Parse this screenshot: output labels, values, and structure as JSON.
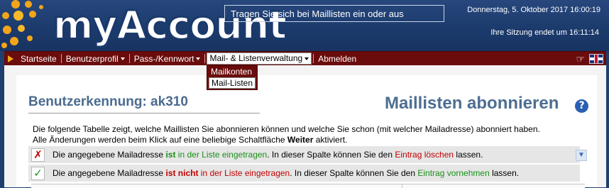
{
  "header": {
    "logo_text": "myAccount",
    "topic": "Tragen Sie sich bei Maillisten ein oder aus",
    "date": "Donnerstag, 5. Oktober 2017 16:00:19",
    "session": "Ihre Sitzung endet um 16:11:14"
  },
  "nav": {
    "items": [
      {
        "label": "Startseite"
      },
      {
        "label": "Benutzerprofil"
      },
      {
        "label": "Pass-/Kennwort"
      },
      {
        "label": "Mail- & Listenverwaltung"
      },
      {
        "label": "Abmelden"
      }
    ],
    "dropdown": [
      {
        "label": "Mailkonten"
      },
      {
        "label": "Mail-Listen"
      }
    ]
  },
  "main": {
    "user_id": "Benutzerkennung: ak310",
    "page_title": "Maillisten abonnieren",
    "intro_line1": "Die folgende Tabelle zeigt, welche Maillisten Sie abonnieren können und welche Sie schon (mit welcher Mailadresse) abonniert haben.",
    "intro_line2_pre": "Alle Änderungen werden beim Klick auf eine beliebige Schaltfläche ",
    "intro_line2_bold": "Weiter",
    "intro_line2_post": " aktiviert.",
    "legend": [
      {
        "icon": "cross-icon",
        "icon_glyph": "✗",
        "icon_color": "#c20000",
        "t1": "Die angegebene Mailadresse ",
        "t2": "ist",
        "t3": " in der Liste eingetragen",
        "t4": ". In dieser Spalte können Sie den ",
        "t5": "Eintrag löschen",
        "t6": " lassen."
      },
      {
        "icon": "check-icon",
        "icon_glyph": "✓",
        "icon_color": "#189018",
        "t1": "Die angegebene Mailadresse ",
        "t2": "ist nicht",
        "t3": " in der Liste eingetragen",
        "t4": ".  In dieser Spalte können Sie den ",
        "t5": "Eintrag vornehmen",
        "t6": " lassen."
      }
    ]
  },
  "colors": {
    "header_bg": "#1f3f6e",
    "nav_bg": "#6b0c0c",
    "title_color": "#4d6e91",
    "red": "#c20000",
    "green": "#189018"
  }
}
